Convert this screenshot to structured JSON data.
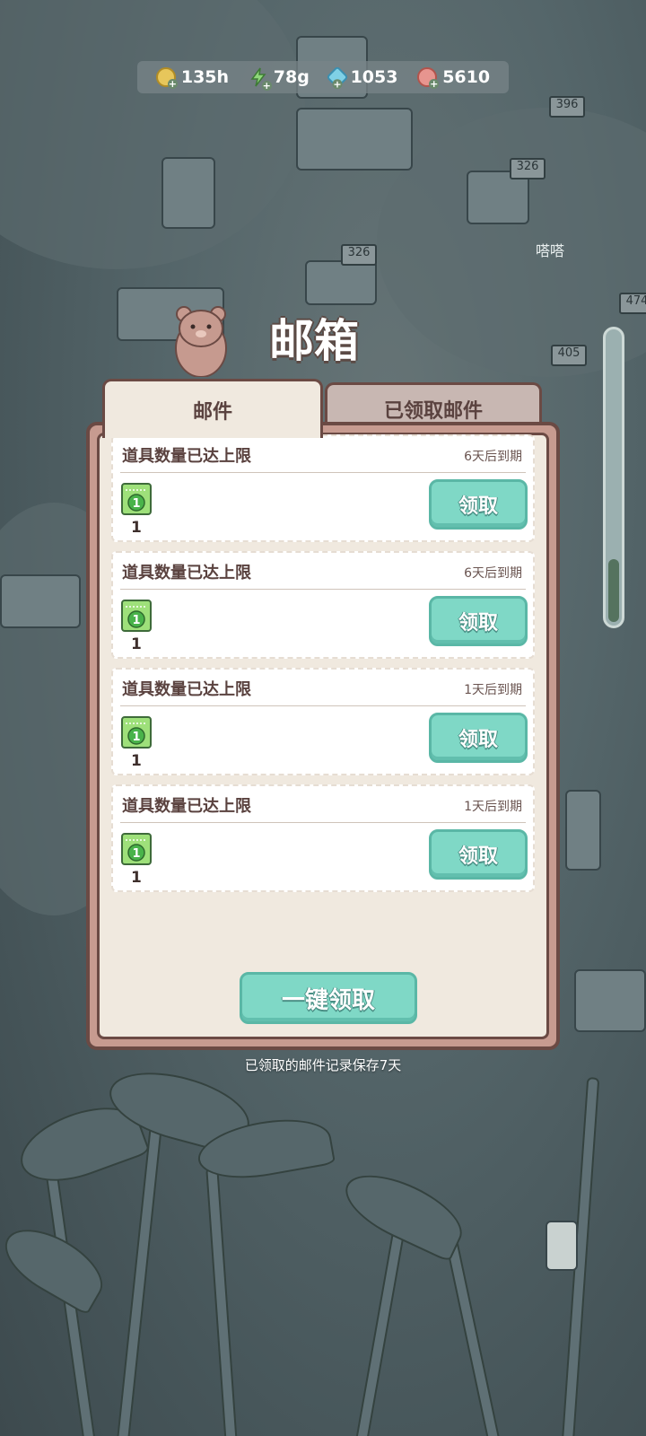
{
  "currency": [
    {
      "icon": "time-coin-icon",
      "value": "135h"
    },
    {
      "icon": "energy-bolt-icon",
      "value": "78g"
    },
    {
      "icon": "blue-gem-icon",
      "value": "1053"
    },
    {
      "icon": "food-icon",
      "value": "5610"
    }
  ],
  "title": "邮箱",
  "tabs": [
    {
      "label": "邮件",
      "active": true
    },
    {
      "label": "已领取邮件",
      "active": false
    }
  ],
  "mails": [
    {
      "title": "道具数量已达上限",
      "expire": "6天后到期",
      "item_icon": "ticket-icon",
      "item_count": "1",
      "item_badge": "1",
      "claim_label": "领取"
    },
    {
      "title": "道具数量已达上限",
      "expire": "6天后到期",
      "item_icon": "ticket-icon",
      "item_count": "1",
      "item_badge": "1",
      "claim_label": "领取"
    },
    {
      "title": "道具数量已达上限",
      "expire": "1天后到期",
      "item_icon": "ticket-icon",
      "item_count": "1",
      "item_badge": "1",
      "claim_label": "领取"
    },
    {
      "title": "道具数量已达上限",
      "expire": "1天后到期",
      "item_icon": "ticket-icon",
      "item_count": "1",
      "item_badge": "1",
      "claim_label": "领取"
    }
  ],
  "claim_all_label": "一键领取",
  "footnote": "已领取的邮件记录保存7天",
  "background_signs": [
    "396",
    "326",
    "326",
    "405",
    "474"
  ],
  "background_text": "嗒嗒",
  "colors": {
    "accent_button": "#7fd8c6",
    "panel_frame": "#c79b90",
    "panel_inner": "#f0e9df",
    "text_brown": "#5a423f"
  }
}
